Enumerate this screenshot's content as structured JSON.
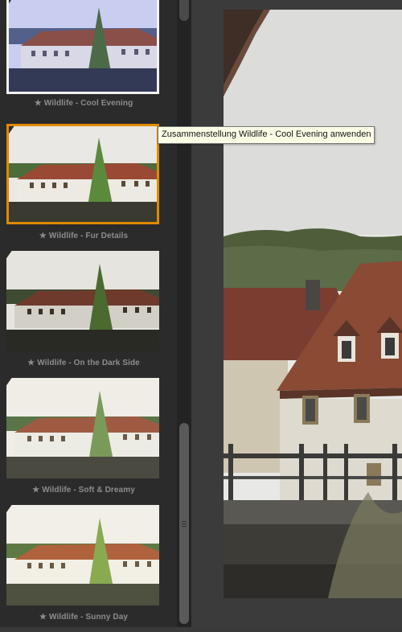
{
  "presets": [
    {
      "label": "Wildlife - Cool Evening",
      "tint": "#b9bde0",
      "state": "selected"
    },
    {
      "label": "Wildlife - Fur Details",
      "tint": "#e9e6dc",
      "state": "hover"
    },
    {
      "label": "Wildlife - On the Dark Side",
      "tint": "#e6e4df",
      "state": "normal"
    },
    {
      "label": "Wildlife - Soft & Dreamy",
      "tint": "#efede6",
      "state": "normal"
    },
    {
      "label": "Wildlife - Sunny Day",
      "tint": "#f1efe8",
      "state": "normal"
    }
  ],
  "tooltip": {
    "text": "Zusammenstellung Wildlife - Cool Evening anwenden"
  },
  "icons": {
    "preset": "star-icon"
  },
  "colors": {
    "hover_border": "#e08a00",
    "selected_border": "#f2f2f2",
    "panel_bg": "#2b2b2b",
    "tooltip_bg": "#ffffe8"
  }
}
